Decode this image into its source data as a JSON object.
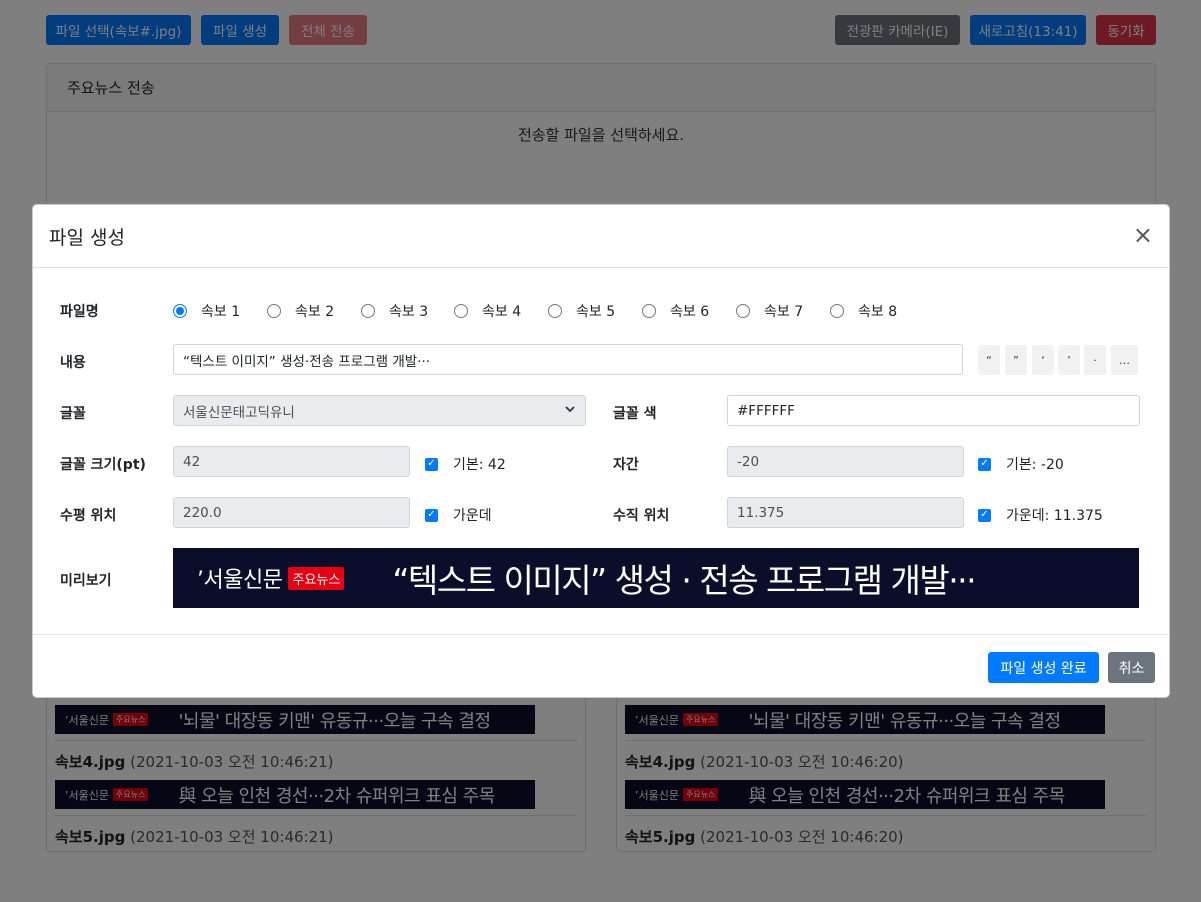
{
  "toolbar": {
    "select_file": "파일 선택(속보#.jpg)",
    "create_file": "파일 생성",
    "send_all": "전체 전송",
    "board_camera": "전광판 카메라(IE)",
    "refresh": "새로고침(13:41)",
    "sync": "동기화"
  },
  "main_card": {
    "title": "주요뉴스 전송",
    "message": "전송할 파일을 선택하세요."
  },
  "lists": [
    {
      "items": [
        {
          "headline": "'뇌물' 대장동 키맨' 유동규···오늘 구속 결정"
        },
        {
          "file": "속보4.jpg",
          "date": "(2021-10-03 오전 10:46:21)",
          "headline": "與 오늘 인천 경선···2차 슈퍼위크 표심 주목"
        },
        {
          "file": "속보5.jpg",
          "date": "(2021-10-03 오전 10:46:21)"
        }
      ]
    },
    {
      "items": [
        {
          "headline": "'뇌물' 대장동 키맨' 유동규···오늘 구속 결정"
        },
        {
          "file": "속보4.jpg",
          "date": "(2021-10-03 오전 10:46:20)",
          "headline": "與 오늘 인천 경선···2차 슈퍼위크 표심 주목"
        },
        {
          "file": "속보5.jpg",
          "date": "(2021-10-03 오전 10:46:20)"
        }
      ]
    }
  ],
  "banner_brand": {
    "logo": "’서울신문",
    "tag": "주요뉴스"
  },
  "modal": {
    "title": "파일 생성",
    "close": "×",
    "labels": {
      "filename": "파일명",
      "content": "내용",
      "font": "글꼴",
      "font_color": "글꼴 색",
      "font_size": "글꼴 크기(pt)",
      "spacing": "자간",
      "h_pos": "수평 위치",
      "v_pos": "수직 위치",
      "preview": "미리보기"
    },
    "radios": [
      "속보 1",
      "속보 2",
      "속보 3",
      "속보 4",
      "속보 5",
      "속보 6",
      "속보 7",
      "속보 8"
    ],
    "selected_radio": 0,
    "content_value": "“텍스트 이미지” 생성·전송 프로그램 개발···",
    "symbols": [
      "“",
      "”",
      "‘",
      "’",
      "·",
      "…"
    ],
    "font_value": "서울신문태고딕유니",
    "font_color_value": "#FFFFFF",
    "font_size_value": "42",
    "font_size_default": "기본: 42",
    "spacing_value": "-20",
    "spacing_default": "기본: -20",
    "h_pos_value": "220.0",
    "h_pos_center": "가운데",
    "v_pos_value": "11.375",
    "v_pos_center": "가운데: 11.375",
    "preview_headline": "“텍스트 이미지” 생성 · 전송 프로그램 개발···",
    "submit": "파일 생성 완료",
    "cancel": "취소"
  },
  "colors": {
    "primary": "#007bff",
    "danger": "#dc3545",
    "secondary": "#6c757d",
    "banner_bg": "#0a0e2a",
    "banner_tag": "#e60012"
  }
}
